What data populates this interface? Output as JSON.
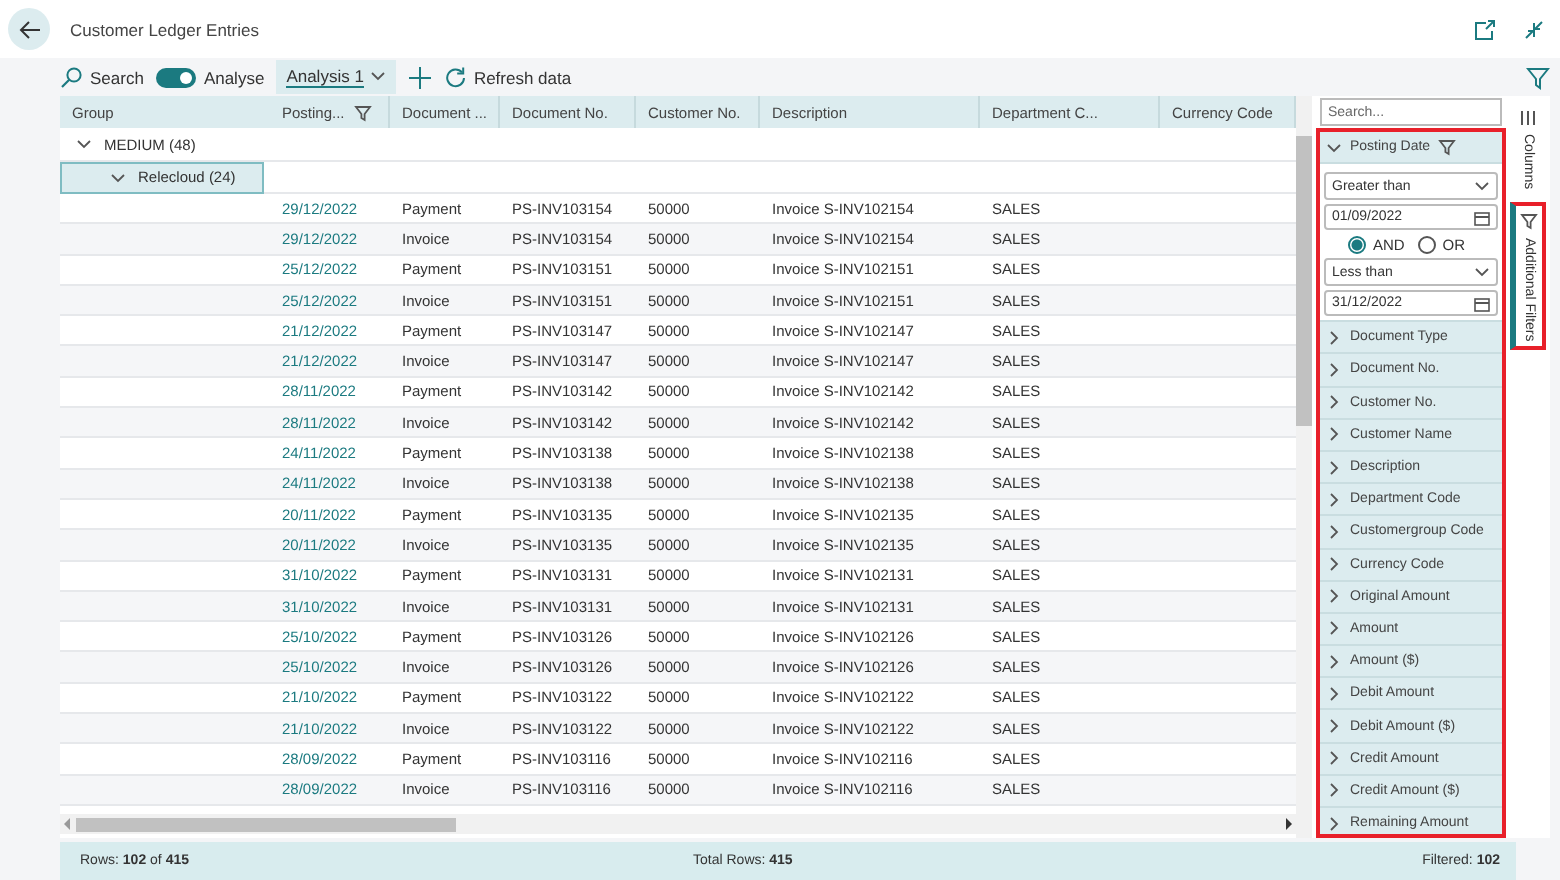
{
  "window": {
    "title": "Customer Ledger Entries"
  },
  "toolbar": {
    "search_label": "Search",
    "analyse": {
      "label": "Analyse",
      "on": true
    },
    "tabs": [
      {
        "label": "Analysis 1",
        "selected": true
      }
    ],
    "refresh_label": "Refresh data"
  },
  "table": {
    "columns": [
      {
        "label": "Group",
        "filtered": false
      },
      {
        "label": "Posting...",
        "filtered": true
      },
      {
        "label": "Document ...",
        "filtered": false
      },
      {
        "label": "Document No.",
        "filtered": false
      },
      {
        "label": "Customer No.",
        "filtered": false
      },
      {
        "label": "Description",
        "filtered": false
      },
      {
        "label": "Department C...",
        "filtered": false
      },
      {
        "label": "Currency Code",
        "filtered": false
      }
    ],
    "groups": [
      {
        "label": "MEDIUM (48)",
        "expanded": true,
        "selected": false,
        "children": [
          {
            "label": "Relecloud (24)",
            "expanded": true,
            "selected": true
          }
        ]
      }
    ],
    "rows": [
      [
        "",
        "29/12/2022",
        "Payment",
        "PS-INV103154",
        "50000",
        "Invoice S-INV102154",
        "SALES",
        ""
      ],
      [
        "",
        "29/12/2022",
        "Invoice",
        "PS-INV103154",
        "50000",
        "Invoice S-INV102154",
        "SALES",
        ""
      ],
      [
        "",
        "25/12/2022",
        "Payment",
        "PS-INV103151",
        "50000",
        "Invoice S-INV102151",
        "SALES",
        ""
      ],
      [
        "",
        "25/12/2022",
        "Invoice",
        "PS-INV103151",
        "50000",
        "Invoice S-INV102151",
        "SALES",
        ""
      ],
      [
        "",
        "21/12/2022",
        "Payment",
        "PS-INV103147",
        "50000",
        "Invoice S-INV102147",
        "SALES",
        ""
      ],
      [
        "",
        "21/12/2022",
        "Invoice",
        "PS-INV103147",
        "50000",
        "Invoice S-INV102147",
        "SALES",
        ""
      ],
      [
        "",
        "28/11/2022",
        "Payment",
        "PS-INV103142",
        "50000",
        "Invoice S-INV102142",
        "SALES",
        ""
      ],
      [
        "",
        "28/11/2022",
        "Invoice",
        "PS-INV103142",
        "50000",
        "Invoice S-INV102142",
        "SALES",
        ""
      ],
      [
        "",
        "24/11/2022",
        "Payment",
        "PS-INV103138",
        "50000",
        "Invoice S-INV102138",
        "SALES",
        ""
      ],
      [
        "",
        "24/11/2022",
        "Invoice",
        "PS-INV103138",
        "50000",
        "Invoice S-INV102138",
        "SALES",
        ""
      ],
      [
        "",
        "20/11/2022",
        "Payment",
        "PS-INV103135",
        "50000",
        "Invoice S-INV102135",
        "SALES",
        ""
      ],
      [
        "",
        "20/11/2022",
        "Invoice",
        "PS-INV103135",
        "50000",
        "Invoice S-INV102135",
        "SALES",
        ""
      ],
      [
        "",
        "31/10/2022",
        "Payment",
        "PS-INV103131",
        "50000",
        "Invoice S-INV102131",
        "SALES",
        ""
      ],
      [
        "",
        "31/10/2022",
        "Invoice",
        "PS-INV103131",
        "50000",
        "Invoice S-INV102131",
        "SALES",
        ""
      ],
      [
        "",
        "25/10/2022",
        "Payment",
        "PS-INV103126",
        "50000",
        "Invoice S-INV102126",
        "SALES",
        ""
      ],
      [
        "",
        "25/10/2022",
        "Invoice",
        "PS-INV103126",
        "50000",
        "Invoice S-INV102126",
        "SALES",
        ""
      ],
      [
        "",
        "21/10/2022",
        "Payment",
        "PS-INV103122",
        "50000",
        "Invoice S-INV102122",
        "SALES",
        ""
      ],
      [
        "",
        "21/10/2022",
        "Invoice",
        "PS-INV103122",
        "50000",
        "Invoice S-INV102122",
        "SALES",
        ""
      ],
      [
        "",
        "28/09/2022",
        "Payment",
        "PS-INV103116",
        "50000",
        "Invoice S-INV102116",
        "SALES",
        ""
      ],
      [
        "",
        "28/09/2022",
        "Invoice",
        "PS-INV103116",
        "50000",
        "Invoice S-INV102116",
        "SALES",
        ""
      ]
    ]
  },
  "filter_panel": {
    "search": {
      "placeholder": "Search..."
    },
    "fields": [
      {
        "label": "Posting Date",
        "expanded": true,
        "filtered": true,
        "conditions": [
          {
            "operator": "Greater than",
            "value": "01/09/2022"
          },
          {
            "operator": "Less than",
            "value": "31/12/2022"
          }
        ],
        "joins": [
          {
            "label": "AND",
            "selected": true
          },
          {
            "label": "OR",
            "selected": false
          }
        ]
      },
      {
        "label": "Document Type",
        "expanded": false,
        "filtered": false
      },
      {
        "label": "Document No.",
        "expanded": false,
        "filtered": false
      },
      {
        "label": "Customer No.",
        "expanded": false,
        "filtered": false
      },
      {
        "label": "Customer Name",
        "expanded": false,
        "filtered": false
      },
      {
        "label": "Description",
        "expanded": false,
        "filtered": false
      },
      {
        "label": "Department Code",
        "expanded": false,
        "filtered": false
      },
      {
        "label": "Customergroup Code",
        "expanded": false,
        "filtered": false
      },
      {
        "label": "Currency Code",
        "expanded": false,
        "filtered": false
      },
      {
        "label": "Original Amount",
        "expanded": false,
        "filtered": false
      },
      {
        "label": "Amount",
        "expanded": false,
        "filtered": false
      },
      {
        "label": "Amount ($)",
        "expanded": false,
        "filtered": false
      },
      {
        "label": "Debit Amount",
        "expanded": false,
        "filtered": false
      },
      {
        "label": "Debit Amount ($)",
        "expanded": false,
        "filtered": false
      },
      {
        "label": "Credit Amount",
        "expanded": false,
        "filtered": false
      },
      {
        "label": "Credit Amount ($)",
        "expanded": false,
        "filtered": false
      },
      {
        "label": "Remaining Amount",
        "expanded": false,
        "filtered": false
      }
    ]
  },
  "side_tabs": [
    {
      "label": "Columns",
      "kind": "columns",
      "selected": false
    },
    {
      "label": "Additional Filters",
      "kind": "filters",
      "selected": true
    }
  ],
  "status_bar": {
    "rows": "Rows: **102** of **415**",
    "total": "Total Rows: **415**",
    "filtered": "Filtered: **102**"
  }
}
